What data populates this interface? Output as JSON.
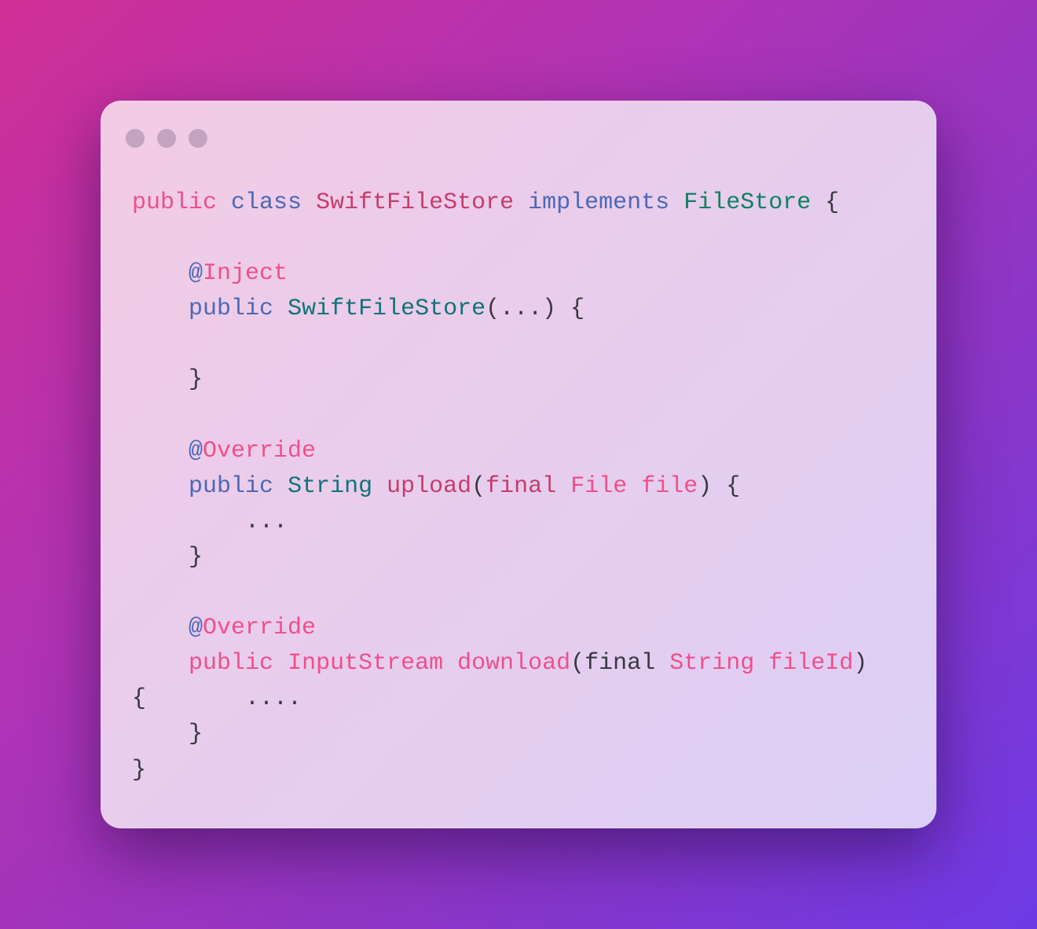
{
  "window": {
    "controls": [
      "close",
      "minimize",
      "maximize"
    ],
    "control_color": "#c3a3bf"
  },
  "colors": {
    "pink": "#f04f8c",
    "blue": "#4c68b6",
    "crimson": "#c63c6c",
    "teal": "#117278",
    "green": "#0b8161",
    "dark": "#3b3842"
  },
  "code": {
    "lines": [
      [
        [
          "pink",
          "public"
        ],
        [
          "dark",
          " "
        ],
        [
          "blue",
          "class"
        ],
        [
          "dark",
          " "
        ],
        [
          "crimson",
          "SwiftFileStore"
        ],
        [
          "dark",
          " "
        ],
        [
          "blue",
          "implements"
        ],
        [
          "dark",
          " "
        ],
        [
          "green",
          "FileStore"
        ],
        [
          "dark",
          " {"
        ]
      ],
      [],
      [
        [
          "dark",
          "    "
        ],
        [
          "blue",
          "@"
        ],
        [
          "pink",
          "Inject"
        ]
      ],
      [
        [
          "dark",
          "    "
        ],
        [
          "blue",
          "public"
        ],
        [
          "dark",
          " "
        ],
        [
          "teal",
          "SwiftFileStore"
        ],
        [
          "dark",
          "(...) {"
        ]
      ],
      [],
      [
        [
          "dark",
          "    }"
        ]
      ],
      [],
      [
        [
          "dark",
          "    "
        ],
        [
          "blue",
          "@"
        ],
        [
          "pink",
          "Override"
        ]
      ],
      [
        [
          "dark",
          "    "
        ],
        [
          "blue",
          "public"
        ],
        [
          "dark",
          " "
        ],
        [
          "teal",
          "String"
        ],
        [
          "dark",
          " "
        ],
        [
          "crimson",
          "upload"
        ],
        [
          "dark",
          "("
        ],
        [
          "crimson",
          "final"
        ],
        [
          "dark",
          " "
        ],
        [
          "pink",
          "File"
        ],
        [
          "dark",
          " "
        ],
        [
          "pink",
          "file"
        ],
        [
          "dark",
          ") {"
        ]
      ],
      [
        [
          "dark",
          "        ..."
        ]
      ],
      [
        [
          "dark",
          "    }"
        ]
      ],
      [],
      [
        [
          "dark",
          "    "
        ],
        [
          "blue",
          "@"
        ],
        [
          "pink",
          "Override"
        ]
      ],
      [
        [
          "dark",
          "    "
        ],
        [
          "pink",
          "public"
        ],
        [
          "dark",
          " "
        ],
        [
          "pink",
          "InputStream"
        ],
        [
          "dark",
          " "
        ],
        [
          "pink",
          "download"
        ],
        [
          "dark",
          "(final "
        ],
        [
          "pink",
          "String"
        ],
        [
          "dark",
          " "
        ],
        [
          "pink",
          "fileId"
        ],
        [
          "dark",
          ")"
        ]
      ],
      [
        [
          "dark",
          "{       ...."
        ]
      ],
      [
        [
          "dark",
          "    }"
        ]
      ],
      [
        [
          "dark",
          "}"
        ]
      ]
    ]
  }
}
